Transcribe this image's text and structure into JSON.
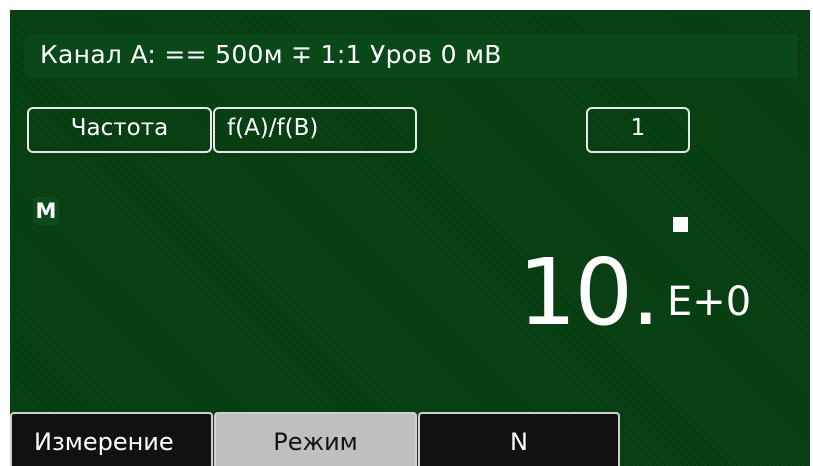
{
  "header": {
    "channel_info": "Канал A: == 500м ∓ 1:1 Уров 0 мВ"
  },
  "controls": {
    "mode_label": "Частота",
    "function_label": "f(A)/f(B)",
    "count_value": "1"
  },
  "indicator": {
    "memory_badge": "M"
  },
  "reading": {
    "value": "10.",
    "exponent": "E+0"
  },
  "tabs": [
    {
      "label": "Измерение",
      "active": false
    },
    {
      "label": "Режим",
      "active": true
    },
    {
      "label": "N",
      "active": false
    }
  ],
  "colors": {
    "screen_background": "#053d10",
    "header_background": "#0a4719",
    "tab_active": "#bfbfbf",
    "tab_inactive": "#111111"
  }
}
